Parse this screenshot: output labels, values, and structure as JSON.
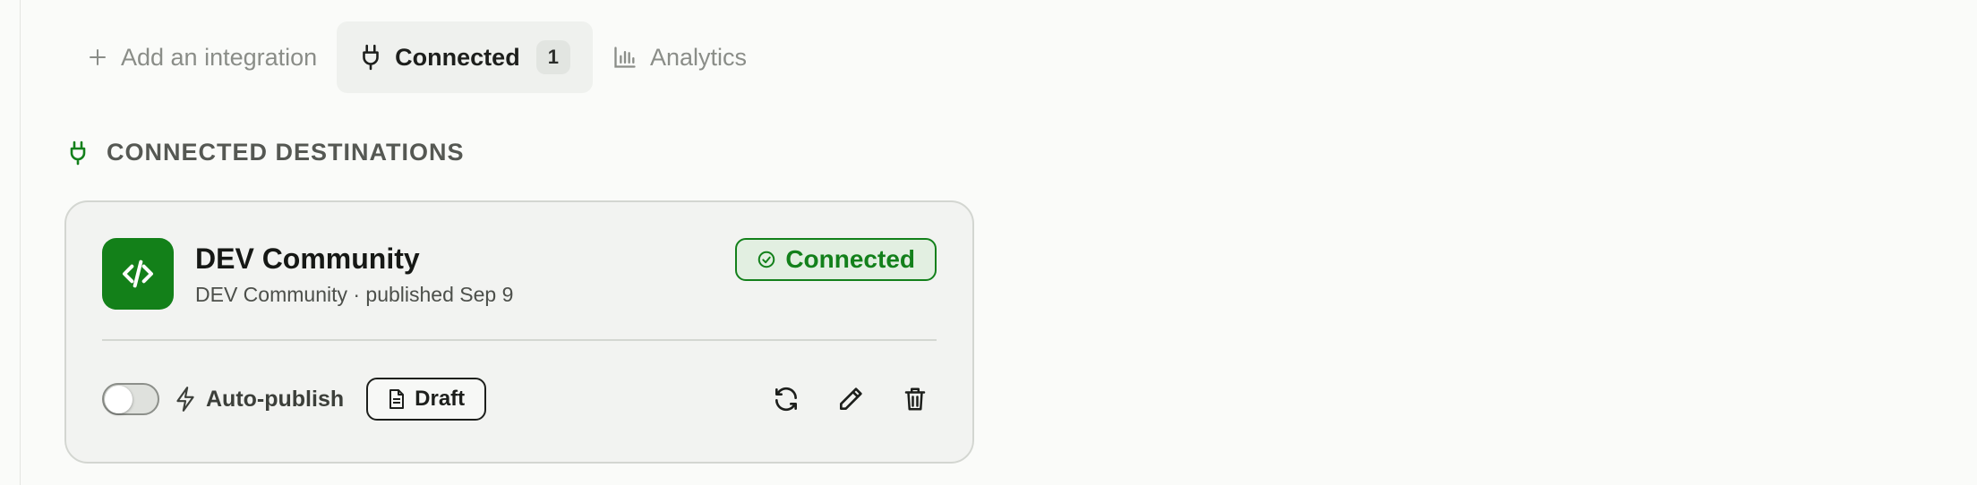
{
  "tabs": [
    {
      "label": "Add an integration",
      "icon": "plus-icon"
    },
    {
      "label": "Connected",
      "icon": "plug-icon",
      "count": "1",
      "active": true
    },
    {
      "label": "Analytics",
      "icon": "bar-chart-icon"
    }
  ],
  "section": {
    "title": "CONNECTED DESTINATIONS",
    "icon": "plug-icon"
  },
  "card": {
    "title": "DEV Community",
    "subtitle": "DEV Community · published Sep 9",
    "logo_icon": "code-icon",
    "status": "Connected",
    "auto_publish_label": "Auto-publish",
    "auto_publish_enabled": false,
    "mode_label": "Draft",
    "actions": [
      "refresh-icon",
      "edit-icon",
      "trash-icon"
    ]
  },
  "colors": {
    "accent_green": "#13801b",
    "background": "#fafbf9",
    "card_bg": "#f2f3f1"
  }
}
